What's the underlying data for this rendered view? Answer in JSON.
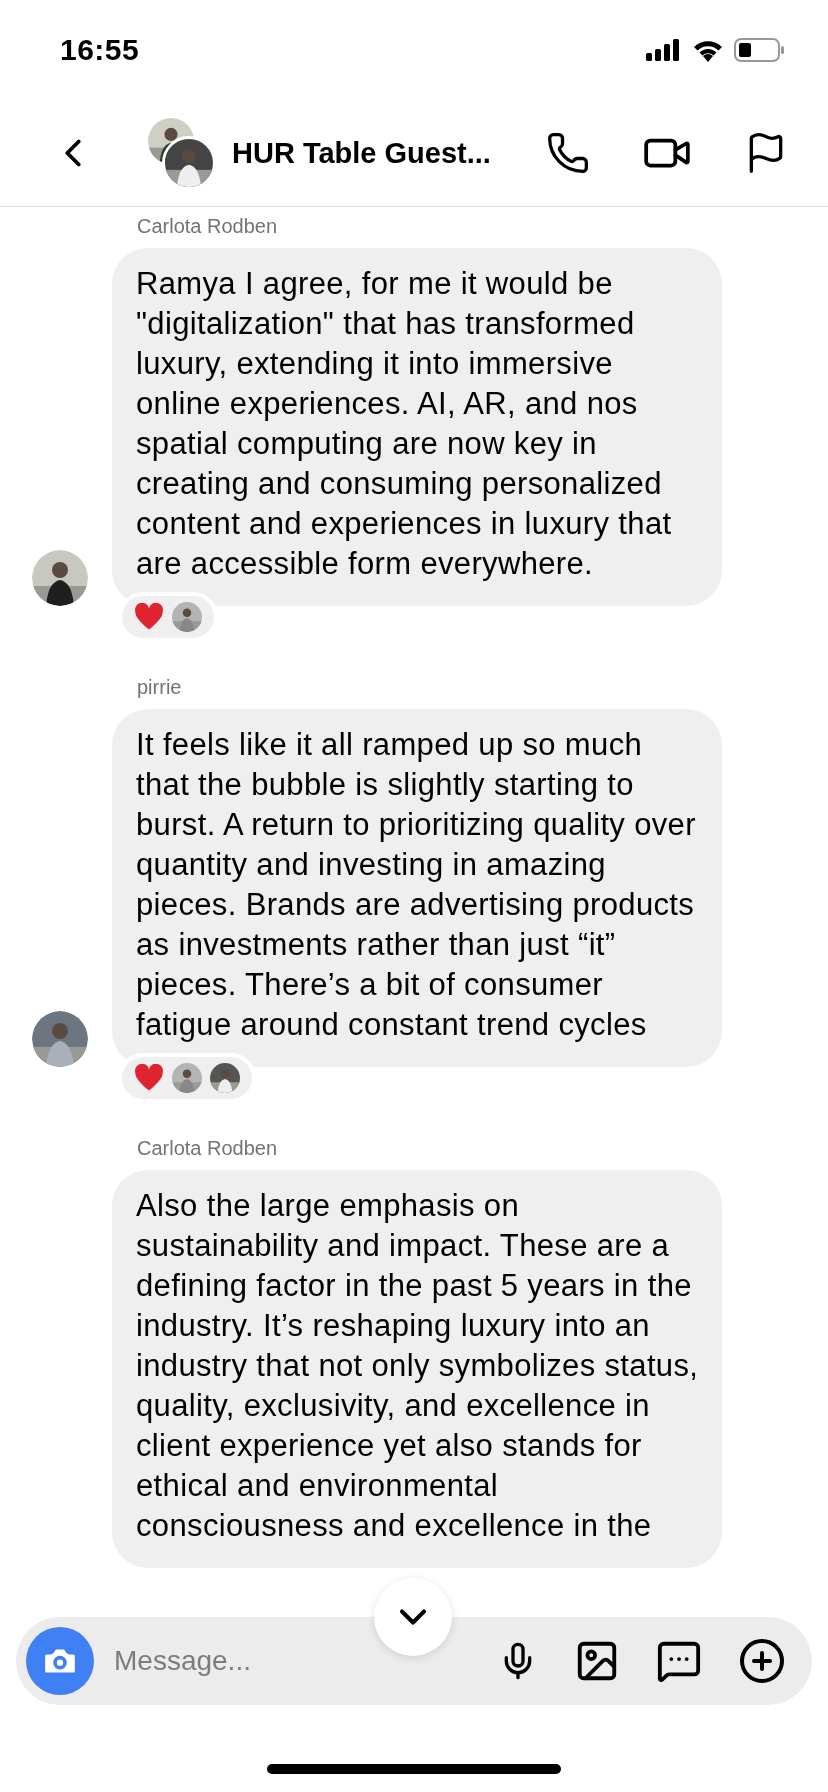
{
  "status_bar": {
    "time": "16:55"
  },
  "header": {
    "title": "HUR Table Guest..."
  },
  "messages": [
    {
      "sender": "Carlota Rodben",
      "text": "Ramya I agree, for me it would be \"digitalization\" that has transformed luxury, extending it into immersive online experiences. AI, AR, and nos spatial computing are now key in creating and consuming personalized content and experiences in luxury that are accessible form everywhere.",
      "reactions": [
        {
          "kind": "heart"
        },
        {
          "kind": "avatar"
        }
      ]
    },
    {
      "sender": "pirrie",
      "text": "It feels like it all ramped up so much that the bubble is slightly starting to burst. A return to prioritizing quality over quantity and investing in amazing pieces. Brands are advertising products as investments rather than just “it” pieces. There’s a bit of consumer fatigue around constant trend cycles",
      "reactions": [
        {
          "kind": "heart"
        },
        {
          "kind": "avatar"
        },
        {
          "kind": "avatar"
        }
      ]
    },
    {
      "sender": "Carlota Rodben",
      "text": "Also the large emphasis on sustainability and impact. These are a defining factor in the past 5 years in the industry. It’s reshaping luxury into an industry that not only symbolizes status, quality, exclusivity, and excellence in client experience yet also stands for ethical and environmental consciousness and excellence in the"
    }
  ],
  "composer": {
    "placeholder": "Message..."
  }
}
